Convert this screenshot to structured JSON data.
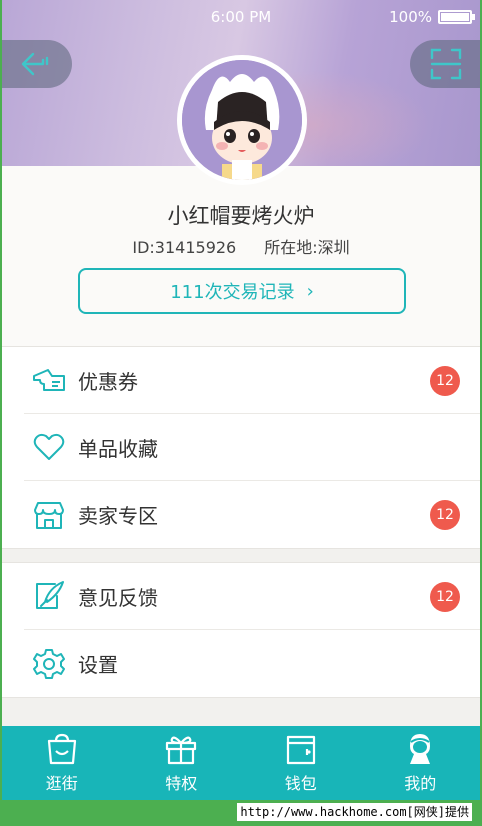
{
  "status_bar": {
    "time": "6:00 PM",
    "battery": "100%"
  },
  "header": {
    "back_icon": "back-arrow-icon",
    "scan_icon": "scan-icon"
  },
  "profile": {
    "name": "小红帽要烤火炉",
    "id_text": "ID:31415926",
    "location_text": "所在地:深圳",
    "trade_button": "111次交易记录",
    "trade_chevron": "›"
  },
  "menu_group_1": [
    {
      "label": "优惠券",
      "icon": "coupon-icon",
      "badge": "12"
    },
    {
      "label": "单品收藏",
      "icon": "heart-icon",
      "badge": ""
    },
    {
      "label": "卖家专区",
      "icon": "store-icon",
      "badge": "12"
    }
  ],
  "menu_group_2": [
    {
      "label": "意见反馈",
      "icon": "feedback-icon",
      "badge": "12"
    },
    {
      "label": "设置",
      "icon": "gear-icon",
      "badge": ""
    }
  ],
  "tabbar": [
    {
      "label": "逛街",
      "icon": "shopping-bag-icon"
    },
    {
      "label": "特权",
      "icon": "gift-icon"
    },
    {
      "label": "钱包",
      "icon": "wallet-icon"
    },
    {
      "label": "我的",
      "icon": "user-icon"
    }
  ],
  "footer_credit": "http://www.hackhome.com[网侠]提供",
  "colors": {
    "accent": "#1fb5b8",
    "badge": "#ef5a4d",
    "header": "#b9a7d6"
  }
}
